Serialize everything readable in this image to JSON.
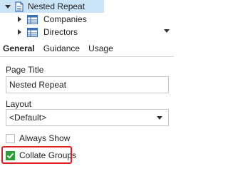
{
  "tree": {
    "items": [
      {
        "label": "Nested Repeat",
        "expanded": true,
        "selected": true,
        "icon": "document-icon"
      },
      {
        "label": "Companies",
        "expanded": false,
        "icon": "grid-icon"
      },
      {
        "label": "Directors",
        "expanded": false,
        "icon": "grid-icon"
      }
    ]
  },
  "tabs": [
    {
      "label": "General",
      "active": true
    },
    {
      "label": "Guidance",
      "active": false
    },
    {
      "label": "Usage",
      "active": false
    }
  ],
  "form": {
    "page_title_label": "Page Title",
    "page_title_value": "Nested Repeat",
    "layout_label": "Layout",
    "layout_value": "<Default>",
    "always_show_label": "Always Show",
    "always_show_checked": false,
    "collate_groups_label": "Collate Groups",
    "collate_groups_checked": true
  },
  "colors": {
    "selection": "#cce4f7",
    "check_green": "#2e9c3a",
    "highlight_red": "#e02020",
    "icon_blue": "#3b6fb6"
  }
}
